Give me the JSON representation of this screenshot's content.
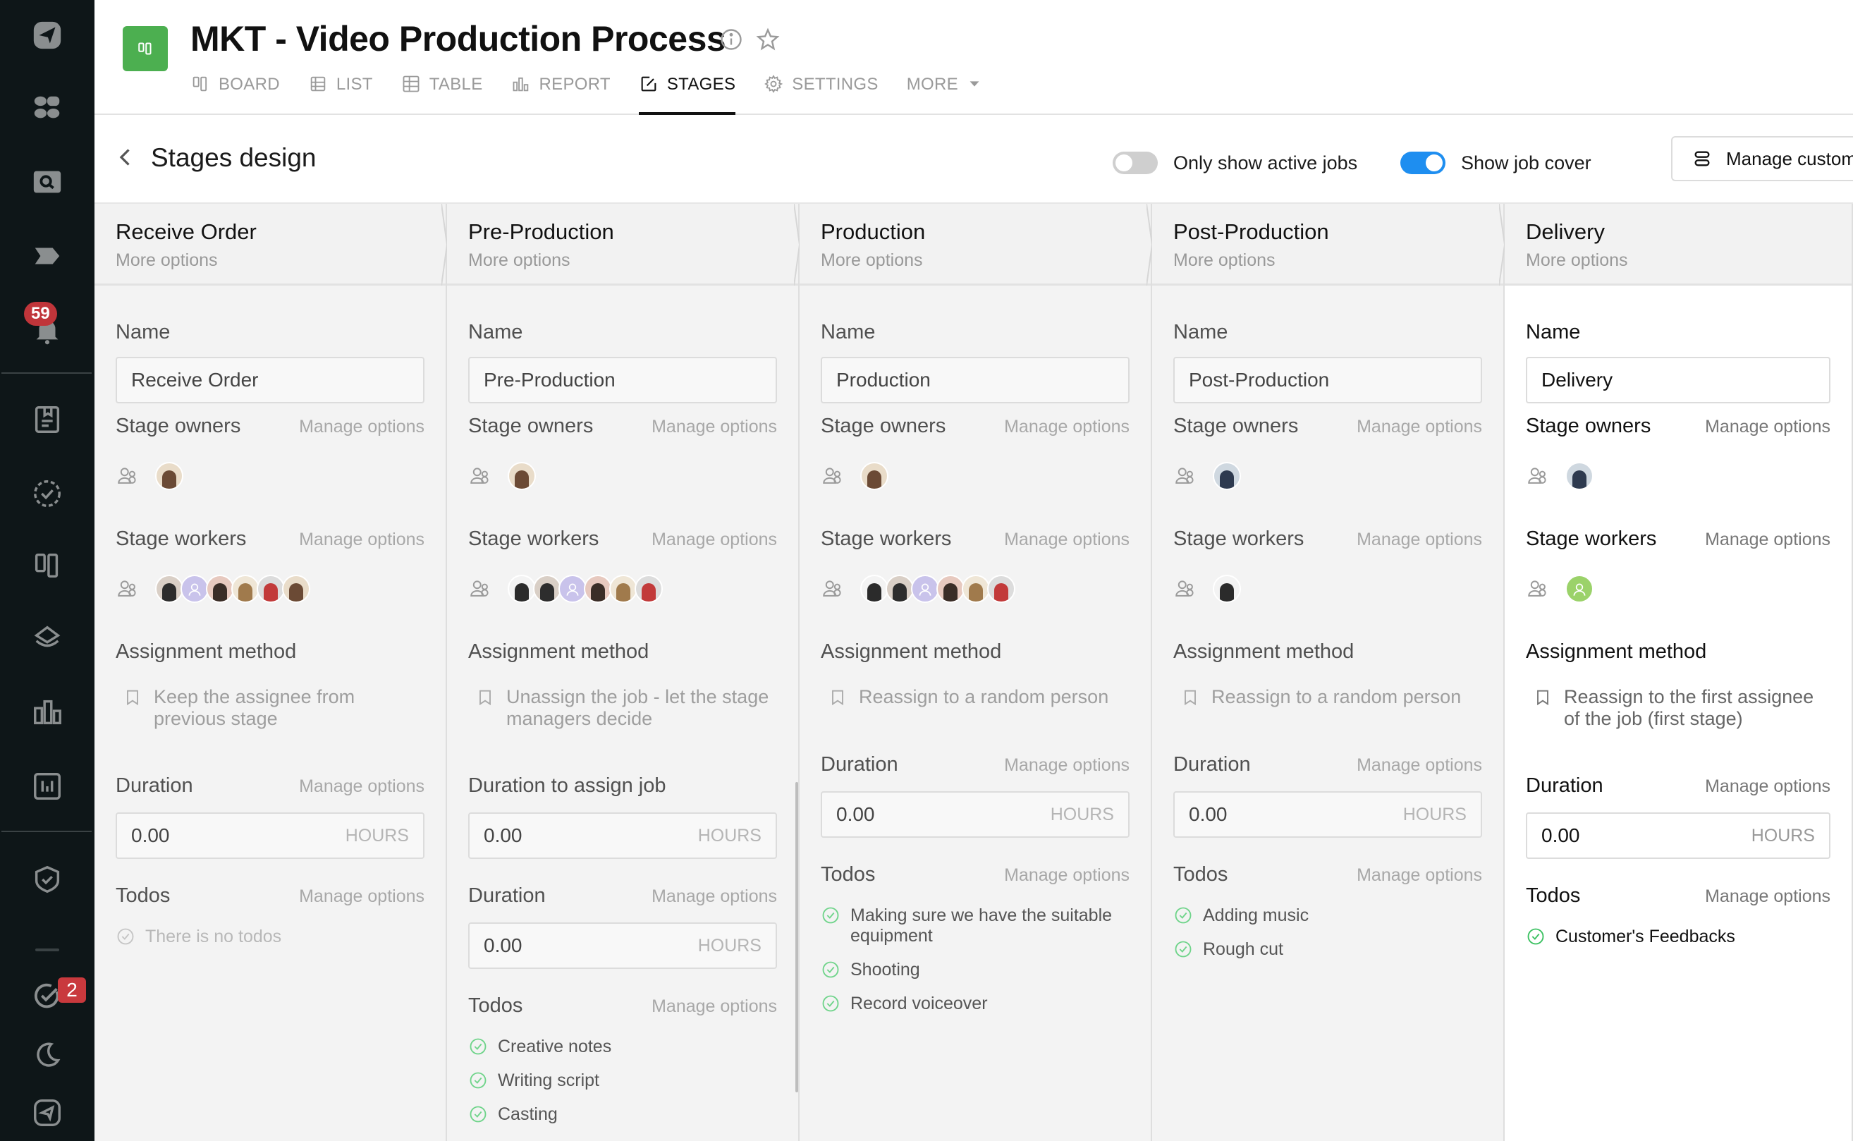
{
  "sidebar": {
    "items": [
      {
        "icon": "send-logo-icon"
      },
      {
        "icon": "apps-grid-icon"
      },
      {
        "icon": "search-icon"
      },
      {
        "icon": "tag-arrow-icon"
      },
      {
        "icon": "bell-icon",
        "badge": "59"
      },
      {
        "icon": "document-bookmark-icon"
      },
      {
        "icon": "dashed-check-circle-icon"
      },
      {
        "icon": "board-columns-icon"
      },
      {
        "icon": "layers-icon"
      },
      {
        "icon": "bar-chart-icon"
      },
      {
        "icon": "report-chart-icon"
      },
      {
        "icon": "shield-check-icon"
      },
      {
        "icon": "check-circle-icon",
        "badge": "2"
      },
      {
        "icon": "moon-icon"
      },
      {
        "icon": "send-icon"
      }
    ]
  },
  "header": {
    "title": "MKT - Video Production Process",
    "tabs": [
      {
        "label": "BOARD",
        "icon": "board-icon",
        "active": false
      },
      {
        "label": "LIST",
        "icon": "list-icon",
        "active": false
      },
      {
        "label": "TABLE",
        "icon": "table-icon",
        "active": false
      },
      {
        "label": "REPORT",
        "icon": "report-icon",
        "active": false
      },
      {
        "label": "STAGES",
        "icon": "edit-icon",
        "active": true
      },
      {
        "label": "SETTINGS",
        "icon": "gear-icon",
        "active": false
      },
      {
        "label": "MORE",
        "icon": "caret-down-icon",
        "active": false
      }
    ]
  },
  "subheader": {
    "title": "Stages design",
    "toggle_active_jobs": {
      "label": "Only show active jobs",
      "on": false
    },
    "toggle_job_cover": {
      "label": "Show job cover",
      "on": true
    },
    "manage_button": "Manage custom"
  },
  "labels": {
    "more_options": "More options",
    "name": "Name",
    "stage_owners": "Stage owners",
    "stage_workers": "Stage workers",
    "assignment_method": "Assignment method",
    "duration": "Duration",
    "duration_to_assign": "Duration to assign job",
    "todos": "Todos",
    "manage_options": "Manage options",
    "hours": "HOURS",
    "no_todos": "There is no todos"
  },
  "stages": [
    {
      "title": "Receive Order",
      "name_value": "Receive Order",
      "owners": [
        "woman-long-hair"
      ],
      "workers": [
        "man-dark-hair",
        "placeholder-purple",
        "man-beard",
        "man-curly",
        "man-red-shirt",
        "woman-long-hair"
      ],
      "assignment": "Keep the assignee from previous stage",
      "duration_to_assign": null,
      "duration": "0.00",
      "todos": []
    },
    {
      "title": "Pre-Production",
      "name_value": "Pre-Production",
      "owners": [
        "woman-long-hair"
      ],
      "workers": [
        "man-standing",
        "man-dark-hair",
        "placeholder-purple",
        "man-beard",
        "man-curly",
        "man-red-shirt"
      ],
      "assignment": "Unassign the job - let the stage managers decide",
      "duration_to_assign": "0.00",
      "duration": "0.00",
      "todos": [
        "Creative notes",
        "Writing script",
        "Casting"
      ]
    },
    {
      "title": "Production",
      "name_value": "Production",
      "owners": [
        "woman-long-hair"
      ],
      "workers": [
        "man-standing",
        "man-dark-hair",
        "placeholder-purple",
        "man-beard",
        "man-curly",
        "man-red-shirt"
      ],
      "assignment": "Reassign to a random person",
      "duration_to_assign": null,
      "duration": "0.00",
      "todos": [
        "Making sure we have the suitable equipment",
        "Shooting",
        "Record voiceover"
      ]
    },
    {
      "title": "Post-Production",
      "name_value": "Post-Production",
      "owners": [
        "man-suit"
      ],
      "workers": [
        "man-standing"
      ],
      "assignment": "Reassign to a random person",
      "duration_to_assign": null,
      "duration": "0.00",
      "todos": [
        "Adding music",
        "Rough cut"
      ]
    },
    {
      "title": "Delivery",
      "name_value": "Delivery",
      "owners": [
        "man-suit"
      ],
      "workers": [
        "placeholder-green"
      ],
      "assignment": "Reassign to the first assignee of the job (first stage)",
      "duration_to_assign": null,
      "duration": "0.00",
      "todos": [
        "Customer's Feedbacks"
      ]
    }
  ],
  "colors": {
    "brand_green": "#4caf50",
    "toggle_on": "#1e8ef0",
    "badge_red": "#c0353a",
    "todo_check": "#4cc86a",
    "sidebar_bg": "#0e1618"
  }
}
